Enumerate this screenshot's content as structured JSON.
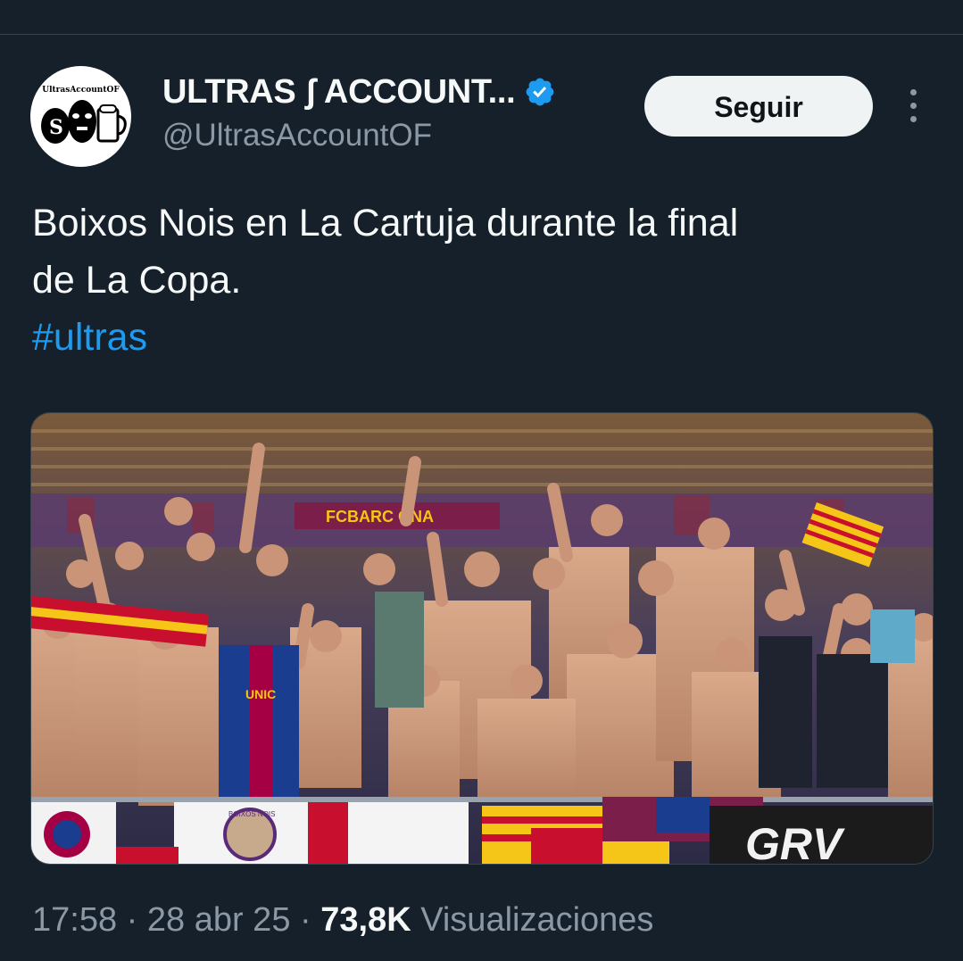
{
  "author": {
    "display_name": "ULTRAS ʃ ACCOUNT...",
    "handle": "@UltrasAccountOF",
    "avatar_text": "UltrasAccountOF",
    "verified": true
  },
  "actions": {
    "follow_label": "Seguir",
    "more_icon": "more-vertical-icon"
  },
  "tweet": {
    "text_line_1": "Boixos Nois en La Cartuja durante la final",
    "text_line_2": "de La Copa.",
    "hashtag": "#ultras"
  },
  "media": {
    "scarf_text": "FCBARC   ONA",
    "shirt_text": "UNIC",
    "banner_text": "GRV",
    "flag_text": "BOIXOS NOIS"
  },
  "meta": {
    "time": "17:58",
    "separator": "·",
    "date": "28 abr 25",
    "views_count": "73,8K",
    "views_label": "Visualizaciones"
  },
  "colors": {
    "background": "#15202b",
    "accent": "#1d9bf0",
    "text_primary": "#f7f9f9",
    "text_secondary": "#8b98a5"
  }
}
